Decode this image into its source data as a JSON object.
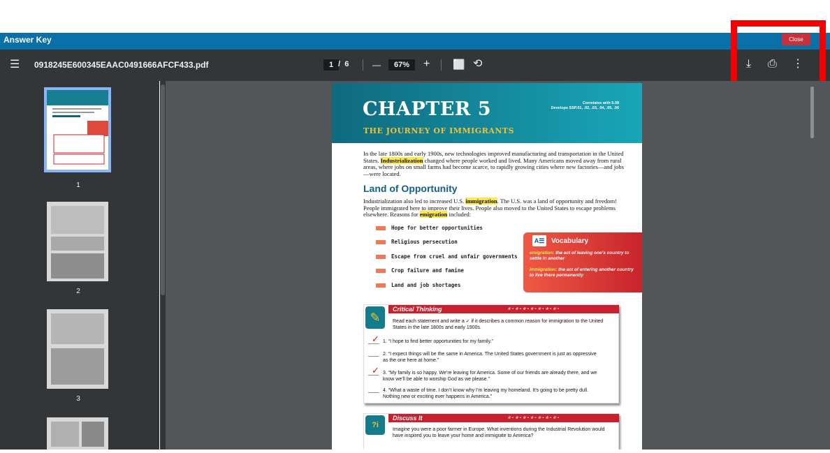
{
  "window": {
    "title": "Answer Key",
    "close_label": "Close"
  },
  "toolbar": {
    "menu_icon": "☰",
    "file_name": "0918245E600345EAAC0491666AFCF433.pdf",
    "current_page": "1",
    "page_sep": "/",
    "total_pages": "6",
    "zoom_out_icon": "—",
    "zoom": "67%",
    "zoom_in_icon": "+",
    "fit_icon": "⬜",
    "rotate_icon": "⟲",
    "download_icon": "⤓",
    "print_icon": "⎙",
    "more_icon": "⋮"
  },
  "sidebar": {
    "thumbnails": [
      {
        "label": "1"
      },
      {
        "label": "2"
      },
      {
        "label": "3"
      }
    ]
  },
  "document": {
    "chapter_title": "CHAPTER 5",
    "chapter_subtitle": "THE JOURNEY OF IMMIGRANTS",
    "correlates_line1": "Correlates with 5.08",
    "correlates_line2": "Develops SSP.01, .02, .03, .04, .05, .06",
    "intro_pre": "In the late 1800s and early 1900s, new technologies improved manufacturing and transportation in the United States. ",
    "intro_term": "Industrialization",
    "intro_post": " changed where people worked and lived. Many Americans moved away from rural areas, where jobs on small farms had become scarce, to rapidly growing cities where new factories—and jobs—were located.",
    "section_heading": "Land of Opportunity",
    "sec_pre": "Industrialization also led to increased U.S. ",
    "sec_term1": "immigration",
    "sec_mid": ". The U.S. was a land of opportunity and freedom! People immigrated here to improve their lives. People also moved to the United States to escape problems elsewhere. Reasons for ",
    "sec_term2": "emigration",
    "sec_post": " included:",
    "reasons": [
      "Hope for better opportunities",
      "Religious persecution",
      "Escape from cruel and unfair governments",
      "Crop failure and famine",
      "Land and job shortages"
    ],
    "vocab": {
      "title": "Vocabulary",
      "icon": "A☰",
      "term1": "emigration:",
      "def1": " the act of leaving one's country to settle in another",
      "term2": "immigration:",
      "def2": " the act of entering another country to live there permanently"
    },
    "critical": {
      "title": "Critical Thinking",
      "stars": "★ • ★ • ★ • ★ • ★ • ★ • ★ •",
      "icon": "✎",
      "instructions": "Read each statement and write a ✓ if it describes a common reason for immigration to the United States in the late 1800s and early 1900s.",
      "items": [
        {
          "blank": "____",
          "check": "✓",
          "text": "1. “I hope to find better opportunities for my family.”"
        },
        {
          "blank": "____",
          "check": "",
          "text": "2. “I expect things will be the same in America. The United States government is just as oppressive as the one here at home.”"
        },
        {
          "blank": "____",
          "check": "✓",
          "text": "3. “My family is so happy. We’re leaving for America. Some of our friends are already there, and we know we’ll be able to worship God as we please.”"
        },
        {
          "blank": "____",
          "check": "",
          "text": "4. “What a waste of time. I don’t know why I’m leaving my homeland. It’s going to be pretty dull. Nothing new or exciting ever happens in America.”"
        }
      ]
    },
    "discuss": {
      "title": "Discuss It",
      "icon": "?i",
      "text": "Imagine you were a poor farmer in Europe. What inventions during the Industrial Revolution would have inspired you to leave your home and immigrate to America?"
    }
  }
}
